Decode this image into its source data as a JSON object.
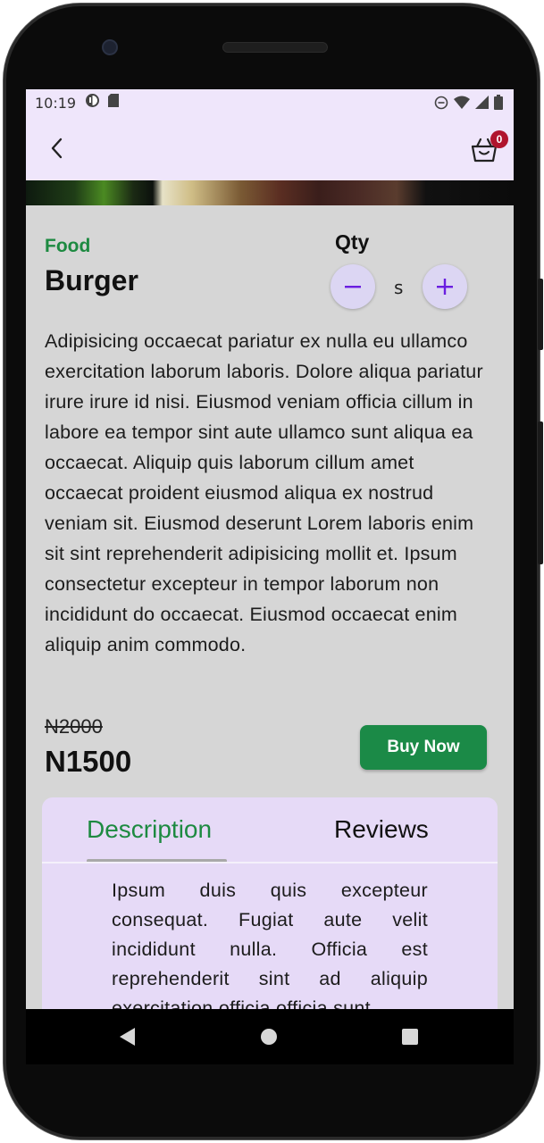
{
  "status_bar": {
    "time": "10:19",
    "icons": [
      "sim-data-icon",
      "sd-card-icon",
      "do-not-disturb-icon",
      "wifi-icon",
      "signal-icon",
      "battery-icon"
    ]
  },
  "app_bar": {
    "back_icon": "chevron-left-icon",
    "cart_icon": "shopping-basket-icon",
    "cart_count": "0"
  },
  "product": {
    "category": "Food",
    "name": "Burger",
    "qty_label": "Qty",
    "qty_value": "s",
    "description": "Adipisicing occaecat pariatur ex nulla eu ullamco exercitation laborum laboris. Dolore aliqua pariatur irure irure id nisi. Eiusmod veniam officia cillum in labore ea tempor sint aute ullamco sunt aliqua ea occaecat. Aliquip quis laborum cillum amet occaecat proident eiusmod aliqua ex nostrud veniam sit. Eiusmod deserunt Lorem laboris enim sit sint reprehenderit adipisicing mollit et. Ipsum consectetur excepteur in tempor laborum non incididunt do occaecat. Eiusmod occaecat enim aliquip anim commodo.",
    "old_price": "N2000",
    "price": "N1500",
    "buy_label": "Buy Now"
  },
  "tabs": {
    "items": [
      {
        "label": "Description",
        "active": true
      },
      {
        "label": "Reviews",
        "active": false
      }
    ],
    "content": "Ipsum duis quis excepteur consequat. Fugiat aute velit incididunt nulla. Officia est reprehenderit sint ad aliquip exercitation officia officia sunt"
  },
  "colors": {
    "accent_green": "#1d8a41",
    "app_bar_bg": "#efe6fb",
    "screen_bg": "#d6d6d6",
    "tab_card_bg": "#e6daf7",
    "qty_icon": "#6a1ee0",
    "badge": "#b0142d"
  },
  "nav_bar": {
    "icons": [
      "nav-back-icon",
      "nav-home-icon",
      "nav-recents-icon"
    ]
  }
}
